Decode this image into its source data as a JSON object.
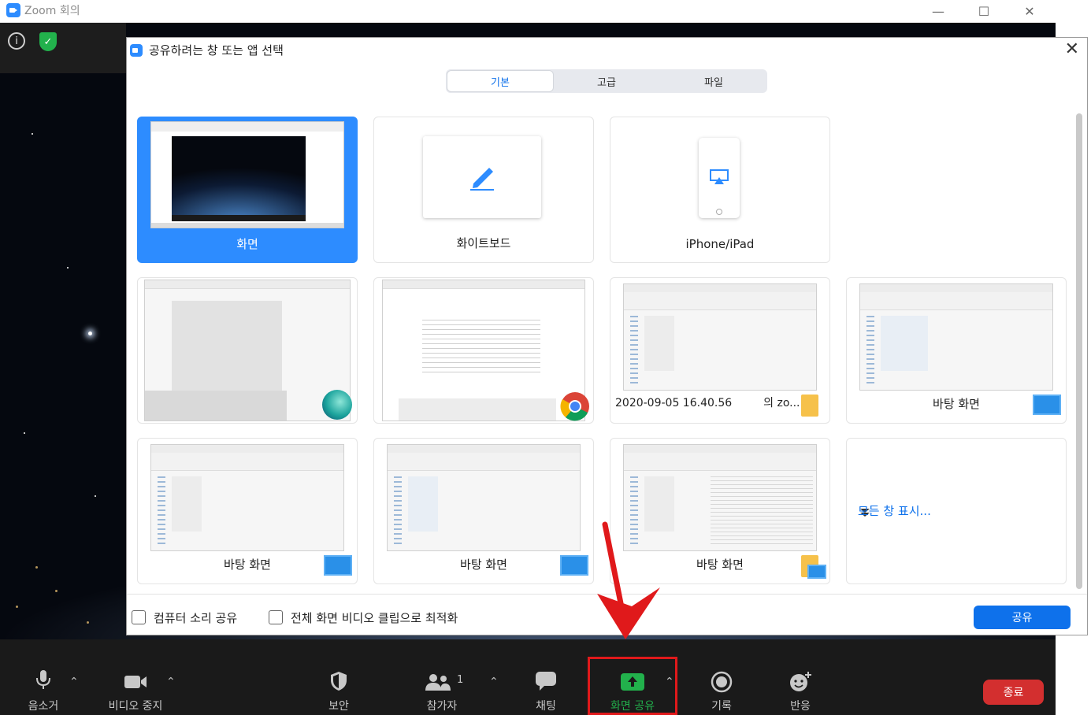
{
  "window": {
    "title": "Zoom 회의",
    "minimize": "—",
    "maximize": "☐",
    "close": "✕"
  },
  "dialog": {
    "title": "공유하려는 창 또는 앱 선택",
    "close": "✕",
    "tabs": [
      {
        "label": "기본",
        "active": true
      },
      {
        "label": "고급",
        "active": false
      },
      {
        "label": "파일",
        "active": false
      }
    ],
    "cards": {
      "screen": "화면",
      "whiteboard": "화이트보드",
      "iphone": "iPhone/iPad",
      "app_folder_label": "2020-09-05 16.40.56",
      "app_folder_suffix": "의 zo...",
      "desktop1": "바탕 화면",
      "desktop2": "바탕 화면",
      "desktop3": "바탕 화면",
      "desktop4": "바탕 화면",
      "show_all": "모든 창 표시..."
    },
    "options": {
      "computer_sound": {
        "label": "컴퓨터 소리 공유",
        "checked": false
      },
      "optimize_video": {
        "label": "전체 화면 비디오 클립으로 최적화",
        "checked": false
      }
    },
    "share_button": "공유"
  },
  "toolbar": {
    "mute": "음소거",
    "stop_video": "비디오 중지",
    "security": "보안",
    "participants": "참가자",
    "participants_count": "1",
    "chat": "채팅",
    "share_screen": "화면 공유",
    "record": "기록",
    "reactions": "반응",
    "end": "종료"
  },
  "colors": {
    "accent": "#0e71eb",
    "selected_card": "#2d8cff",
    "share_green": "#22b14c",
    "end_red": "#d32f2f",
    "highlight_red": "#e0191b"
  }
}
